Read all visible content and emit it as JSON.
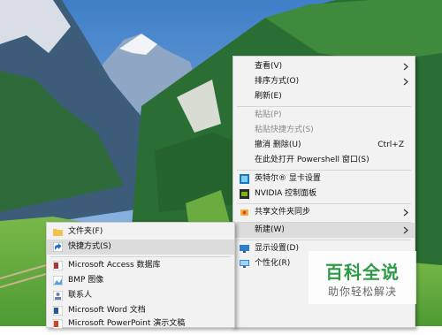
{
  "context_menu": {
    "view": "查看(V)",
    "sort_by": "排序方式(O)",
    "refresh": "刷新(E)",
    "paste": "粘贴(P)",
    "paste_shortcut": "粘贴快捷方式(S)",
    "undo_delete": "撤消 删除(U)",
    "undo_shortcut": "Ctrl+Z",
    "open_powershell": "在此处打开 Powershell 窗口(S)",
    "intel_graphics": "英特尔® 显卡设置",
    "nvidia_panel": "NVIDIA 控制面板",
    "share_folder_sync": "共享文件夹同步",
    "new": "新建(W)",
    "display_settings": "显示设置(D)",
    "personalize": "个性化(R)"
  },
  "new_submenu": {
    "folder": "文件夹(F)",
    "shortcut": "快捷方式(S)",
    "access_db": "Microsoft Access 数据库",
    "bmp_image": "BMP 图像",
    "contact": "联系人",
    "word_doc": "Microsoft Word 文档",
    "powerpoint": "Microsoft PowerPoint 演示文稿"
  },
  "watermark": {
    "title": "百科全说",
    "subtitle": "助你轻松解决"
  },
  "colors": {
    "sky": "#5f93cf",
    "grass": "#5aa13c",
    "forest": "#1d5e2c",
    "watermark_green": "#2e9a46"
  }
}
